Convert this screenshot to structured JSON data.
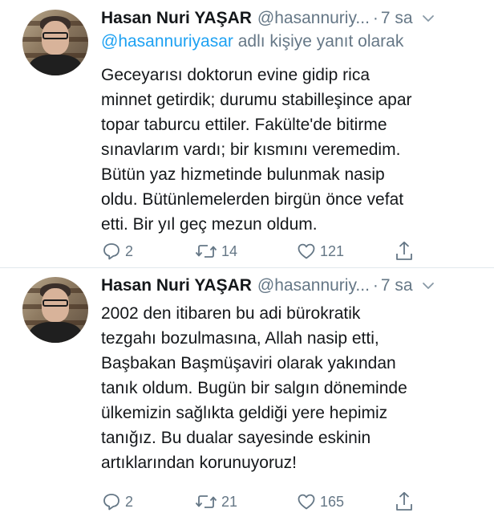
{
  "tweets": [
    {
      "name": "Hasan Nuri YAŞAR",
      "handle": "@hasannuriy...",
      "separator": "·",
      "time": "7 sa",
      "reply_prefix": "@hasannuriyasar",
      "reply_suffix": " adlı kişiye yanıt olarak",
      "text": "Geceyarısı doktorun evine gidip rica\nminnet getirdik; durumu stabilleşince apar\ntopar taburcu ettiler. Fakülte'de bitirme\nsınavlarım vardı; bir kısmını veremedim.\nBütün yaz hizmetinde bulunmak nasip\noldu. Bütünlemelerden birgün önce vefat\netti. Bir yıl geç mezun oldum.",
      "replies": "2",
      "retweets": "14",
      "likes": "121"
    },
    {
      "name": "Hasan Nuri YAŞAR",
      "handle": "@hasannuriy...",
      "separator": "·",
      "time": "7 sa",
      "text": "2002 den itibaren bu adi bürokratik\ntezgahı bozulmasına, Allah nasip etti,\nBaşbakan Başmüşaviri olarak yakından\ntanık oldum. Bugün bir salgın döneminde\nülkemizin sağlıkta geldiği yere hepimiz\ntanığız. Bu dualar sayesinde eskinin\nartıklarından korunuyoruz!",
      "replies": "2",
      "retweets": "21",
      "likes": "165"
    }
  ],
  "icons": {
    "reply": "reply-icon",
    "retweet": "retweet-icon",
    "like": "heart-icon",
    "share": "share-icon",
    "menu": "chevron-down-icon"
  },
  "colors": {
    "text": "#14171a",
    "secondary": "#657786",
    "link": "#1da1f2",
    "divider": "#e1e8ed"
  }
}
